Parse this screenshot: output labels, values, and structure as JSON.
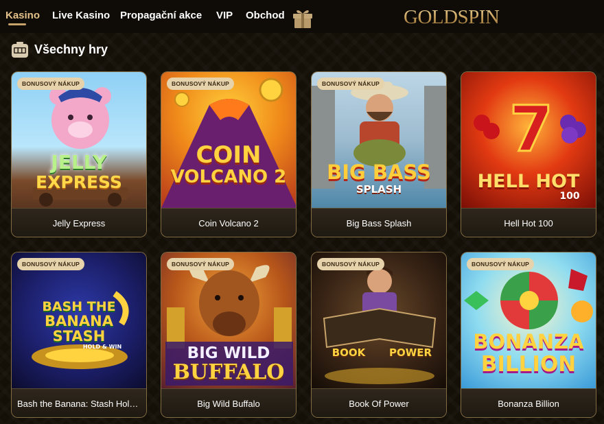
{
  "nav": {
    "items": [
      {
        "label": "Kasino",
        "active": true
      },
      {
        "label": "Live Kasino"
      },
      {
        "label": "Propagační akce"
      },
      {
        "label": "VIP"
      },
      {
        "label": "Obchod"
      }
    ],
    "gift_icon": "gift-icon",
    "logo_text": "GOLDSPIN"
  },
  "section": {
    "icon": "slot-machine-icon",
    "title": "Všechny hry"
  },
  "games": [
    {
      "name": "Jelly Express",
      "badge": "BONUSOVÝ NÁKUP",
      "art_lines": [
        "JELLY",
        "EXPRESS"
      ]
    },
    {
      "name": "Coin Volcano 2",
      "badge": "BONUSOVÝ NÁKUP",
      "art_lines": [
        "COIN",
        "VOLCANO 2"
      ]
    },
    {
      "name": "Big Bass Splash",
      "badge": "BONUSOVÝ NÁKUP",
      "art_lines": [
        "BIG BASS",
        "SPLASH"
      ]
    },
    {
      "name": "Hell Hot 100",
      "badge": "",
      "art_lines": [
        "HELL HOT",
        "100"
      ]
    },
    {
      "name": "Bash the Banana: Stash Hold...",
      "badge": "BONUSOVÝ NÁKUP",
      "art_lines": [
        "BASH THE",
        "BANANA",
        "STASH",
        "HOLD & WIN"
      ]
    },
    {
      "name": "Big Wild Buffalo",
      "badge": "BONUSOVÝ NÁKUP",
      "art_lines": [
        "BIG WILD",
        "BUFFALO"
      ]
    },
    {
      "name": "Book Of Power",
      "badge": "BONUSOVÝ NÁKUP",
      "art_lines": [
        "BOOK",
        "POWER"
      ]
    },
    {
      "name": "Bonanza Billion",
      "badge": "BONUSOVÝ NÁKUP",
      "art_lines": [
        "BONANZA",
        "BILLION"
      ]
    }
  ],
  "colors": {
    "accent": "#e4c28a",
    "badge_bg": "#e6d2ab",
    "card_border": "#d4af6e"
  }
}
